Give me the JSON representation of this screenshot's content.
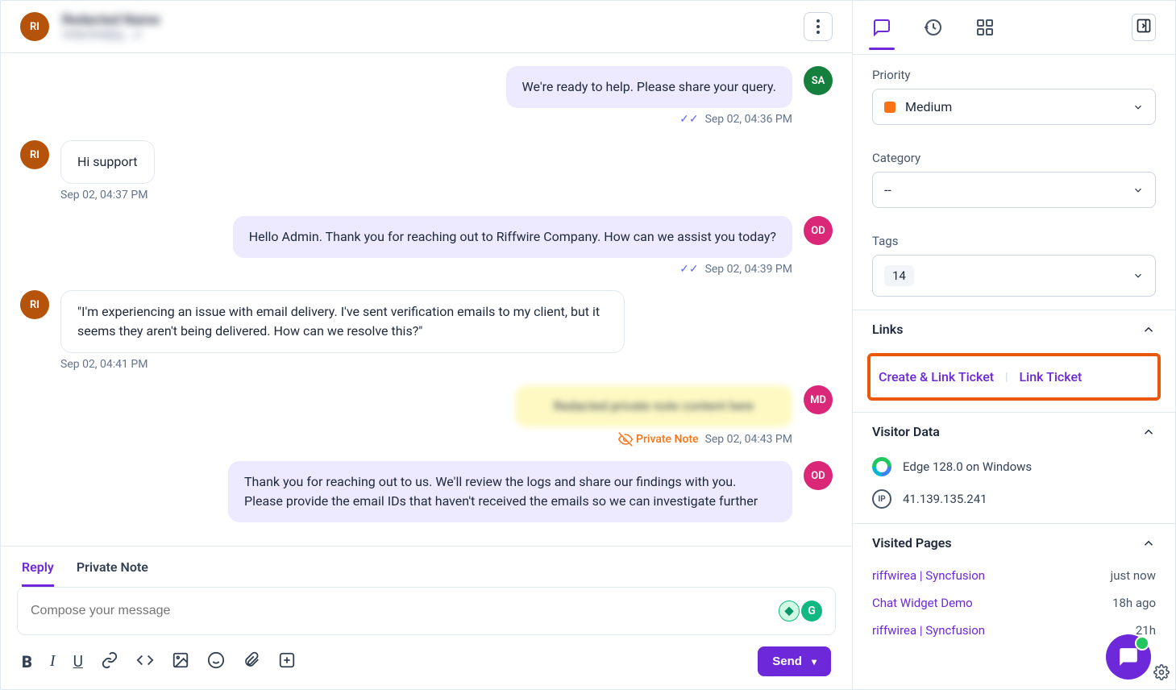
{
  "header": {
    "avatar": "RI",
    "name": "Redacted Name",
    "email": "redacted@g....n"
  },
  "messages": [
    {
      "side": "right",
      "avatar": "SA",
      "avatarClass": "sa",
      "bubbleClass": "purple",
      "text": "We're ready to help. Please share your query.",
      "ts": "Sep 02, 04:36 PM",
      "read": true
    },
    {
      "side": "left",
      "avatar": "RI",
      "avatarClass": "ri",
      "bubbleClass": "white",
      "text": "Hi support",
      "ts": "Sep 02, 04:37 PM"
    },
    {
      "side": "right",
      "avatar": "OD",
      "avatarClass": "od",
      "bubbleClass": "purple",
      "text": "Hello Admin. Thank you for reaching out to Riffwire Company. How can we assist you today?",
      "ts": "Sep 02, 04:39 PM",
      "read": true
    },
    {
      "side": "left",
      "avatar": "RI",
      "avatarClass": "ri",
      "bubbleClass": "white",
      "text": "\"I'm experiencing an issue with email delivery. I've sent verification emails to my client, but it seems they aren't being delivered. How can we resolve this?\"",
      "ts": "Sep 02, 04:41 PM"
    },
    {
      "side": "right",
      "avatar": "MD",
      "avatarClass": "md",
      "bubbleClass": "yellow",
      "text": "Redacted private note content here",
      "ts": "Sep 02, 04:43 PM",
      "private": true
    },
    {
      "side": "right",
      "avatar": "OD",
      "avatarClass": "od",
      "bubbleClass": "purple",
      "text": "Thank you for reaching out to us. We'll review the logs and share our findings with you. Please provide the email IDs that haven't received the emails so we can investigate further",
      "ts": ""
    }
  ],
  "privateNoteLabel": "Private Note",
  "composer": {
    "tabs": [
      "Reply",
      "Private Note"
    ],
    "placeholder": "Compose your message",
    "send": "Send"
  },
  "sidebar": {
    "priority": {
      "label": "Priority",
      "value": "Medium"
    },
    "category": {
      "label": "Category",
      "value": "--"
    },
    "tags": {
      "label": "Tags",
      "value": "14"
    },
    "links": {
      "title": "Links",
      "create": "Create & Link Ticket",
      "link": "Link Ticket"
    },
    "visitor": {
      "title": "Visitor Data",
      "browser": "Edge 128.0 on Windows",
      "ip": "41.139.135.241",
      "ipLabel": "IP"
    },
    "visited": {
      "title": "Visited Pages",
      "rows": [
        {
          "page": "riffwirea | Syncfusion",
          "time": "just now"
        },
        {
          "page": "Chat Widget Demo",
          "time": "18h ago"
        },
        {
          "page": "riffwirea | Syncfusion",
          "time": "21h"
        }
      ]
    }
  }
}
